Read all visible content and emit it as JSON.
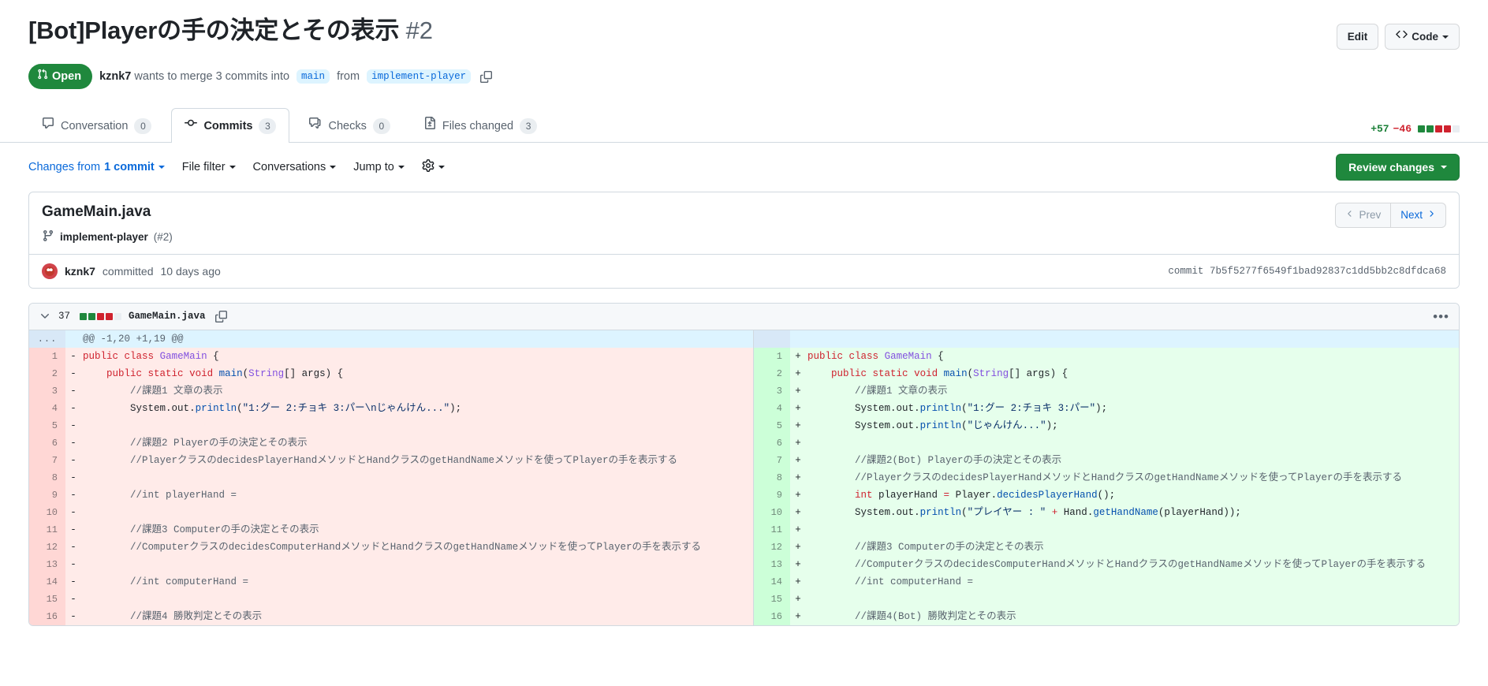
{
  "header": {
    "title": "[Bot]Playerの手の決定とその表示",
    "number": "#2",
    "edit_label": "Edit",
    "code_label": "Code",
    "state": "Open",
    "meta_author": "kznk7",
    "meta_text_1": "wants to merge 3 commits into",
    "base_branch": "main",
    "meta_text_2": "from",
    "head_branch": "implement-player"
  },
  "tabs": [
    {
      "label": "Conversation",
      "count": "0",
      "icon": "comment-icon",
      "selected": false
    },
    {
      "label": "Commits",
      "count": "3",
      "icon": "commit-icon",
      "selected": true
    },
    {
      "label": "Checks",
      "count": "0",
      "icon": "checklist-icon",
      "selected": false
    },
    {
      "label": "Files changed",
      "count": "3",
      "icon": "file-diff-icon",
      "selected": false
    }
  ],
  "diffstat": {
    "additions": "+57",
    "deletions": "−46",
    "blocks": [
      "g",
      "g",
      "r",
      "r",
      "n"
    ]
  },
  "toolbar": {
    "changes_from_prefix": "Changes from",
    "changes_from_value": "1 commit",
    "file_filter": "File filter",
    "conversations": "Conversations",
    "jump_to": "Jump to",
    "settings_icon": "gear-icon",
    "review_changes": "Review changes"
  },
  "file_card": {
    "file_title": "GameMain.java",
    "branch_name": "implement-player",
    "branch_pr_ref": "(#2)",
    "prev_label": "Prev",
    "next_label": "Next",
    "commit_author": "kznk7",
    "commit_verb": "committed",
    "commit_time": "10 days ago",
    "commit_sha_label": "commit",
    "commit_sha": "7b5f5277f6549f1bad92837c1dd5bb2c8dfdca68"
  },
  "diff_header": {
    "change_count": "37",
    "blocks": [
      "g",
      "g",
      "r",
      "r",
      "n"
    ],
    "filename": "GameMain.java",
    "copy_icon": "copy-icon",
    "collapse_icon": "chevron-down-icon",
    "menu_icon": "kebab-icon"
  },
  "hunk": {
    "ellipsis": "...",
    "range": "@@ -1,20 +1,19 @@"
  },
  "diff_rows": [
    {
      "type": "del_add",
      "left": {
        "num": "1",
        "mark": "-",
        "code": "public class GameMain {"
      },
      "right": {
        "num": "1",
        "mark": "+",
        "code": "public class GameMain {"
      }
    },
    {
      "type": "del_add",
      "left": {
        "num": "2",
        "mark": "-",
        "code": "    public static void main(String[] args) {"
      },
      "right": {
        "num": "2",
        "mark": "+",
        "code": "    public static void main(String[] args) {"
      }
    },
    {
      "type": "del_add",
      "left": {
        "num": "3",
        "mark": "-",
        "code": "        //課題1 文章の表示"
      },
      "right": {
        "num": "3",
        "mark": "+",
        "code": "        //課題1 文章の表示"
      }
    },
    {
      "type": "del_add",
      "left": {
        "num": "4",
        "mark": "-",
        "code": "        System.out.println(\"1:グー 2:チョキ 3:パー\\nじゃんけん...\");"
      },
      "right": {
        "num": "4",
        "mark": "+",
        "code": "        System.out.println(\"1:グー 2:チョキ 3:パー\");"
      }
    },
    {
      "type": "del_add",
      "left": {
        "num": "5",
        "mark": "-",
        "code": ""
      },
      "right": {
        "num": "5",
        "mark": "+",
        "code": "        System.out.println(\"じゃんけん...\");"
      }
    },
    {
      "type": "del_add",
      "left": {
        "num": "6",
        "mark": "-",
        "code": "        //課題2 Playerの手の決定とその表示"
      },
      "right": {
        "num": "6",
        "mark": "+",
        "code": ""
      }
    },
    {
      "type": "del_add",
      "left": {
        "num": "7",
        "mark": "-",
        "code": "        //PlayerクラスのdecidesPlayerHandメソッドとHandクラスのgetHandNameメソッドを使ってPlayerの手を表示する"
      },
      "right": {
        "num": "7",
        "mark": "+",
        "code": "        //課題2(Bot) Playerの手の決定とその表示"
      }
    },
    {
      "type": "del_add",
      "left": {
        "num": "8",
        "mark": "-",
        "code": ""
      },
      "right": {
        "num": "8",
        "mark": "+",
        "code": "        //PlayerクラスのdecidesPlayerHandメソッドとHandクラスのgetHandNameメソッドを使ってPlayerの手を表示する"
      }
    },
    {
      "type": "del_add",
      "left": {
        "num": "9",
        "mark": "-",
        "code": "        //int playerHand ="
      },
      "right": {
        "num": "9",
        "mark": "+",
        "code": "        int playerHand = Player.decidesPlayerHand();"
      }
    },
    {
      "type": "del_add",
      "left": {
        "num": "10",
        "mark": "-",
        "code": ""
      },
      "right": {
        "num": "10",
        "mark": "+",
        "code": "        System.out.println(\"プレイヤー : \" + Hand.getHandName(playerHand));"
      }
    },
    {
      "type": "del_add",
      "left": {
        "num": "11",
        "mark": "-",
        "code": "        //課題3 Computerの手の決定とその表示"
      },
      "right": {
        "num": "11",
        "mark": "+",
        "code": ""
      }
    },
    {
      "type": "del_add",
      "left": {
        "num": "12",
        "mark": "-",
        "code": "        //ComputerクラスのdecidesComputerHandメソッドとHandクラスのgetHandNameメソッドを使ってPlayerの手を表示する"
      },
      "right": {
        "num": "12",
        "mark": "+",
        "code": "        //課題3 Computerの手の決定とその表示"
      }
    },
    {
      "type": "del_add",
      "left": {
        "num": "13",
        "mark": "-",
        "code": ""
      },
      "right": {
        "num": "13",
        "mark": "+",
        "code": "        //ComputerクラスのdecidesComputerHandメソッドとHandクラスのgetHandNameメソッドを使ってPlayerの手を表示する"
      }
    },
    {
      "type": "del_add",
      "left": {
        "num": "14",
        "mark": "-",
        "code": "        //int computerHand ="
      },
      "right": {
        "num": "14",
        "mark": "+",
        "code": "        //int computerHand ="
      }
    },
    {
      "type": "del_add",
      "left": {
        "num": "15",
        "mark": "-",
        "code": ""
      },
      "right": {
        "num": "15",
        "mark": "+",
        "code": ""
      }
    },
    {
      "type": "del_add",
      "left": {
        "num": "16",
        "mark": "-",
        "code": "        //課題4 勝敗判定とその表示"
      },
      "right": {
        "num": "16",
        "mark": "+",
        "code": "        //課題4(Bot) 勝敗判定とその表示"
      }
    }
  ]
}
